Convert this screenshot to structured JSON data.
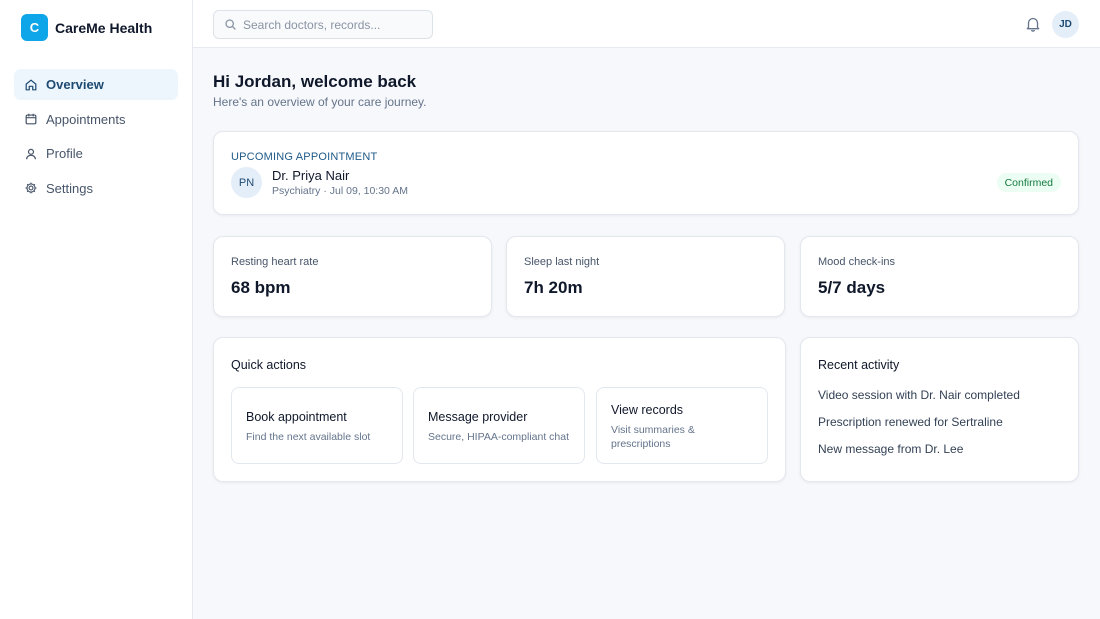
{
  "brand": {
    "logo_letter": "C",
    "name": "CareMe Health",
    "color": "#0ea5e9"
  },
  "nav": {
    "items": [
      {
        "label": "Overview",
        "icon": "home-icon",
        "active": true
      },
      {
        "label": "Appointments",
        "icon": "calendar-icon",
        "active": false
      },
      {
        "label": "Profile",
        "icon": "user-icon",
        "active": false
      },
      {
        "label": "Settings",
        "icon": "gear-icon",
        "active": false
      }
    ]
  },
  "topbar": {
    "search_placeholder": "Search doctors, records...",
    "notifications_icon": "bell-icon",
    "avatar_initials": "JD"
  },
  "main": {
    "greeting": "Hi Jordan, welcome back",
    "subtitle": "Here's an overview of your care journey."
  },
  "appointment": {
    "label": "UPCOMING APPOINTMENT",
    "doctor_initials": "PN",
    "doctor": "Dr. Priya Nair",
    "detail": "Psychiatry · Jul 09, 10:30 AM",
    "status": "Confirmed",
    "status_color": "#147a3f"
  },
  "stats": [
    {
      "label": "Resting heart rate",
      "value": "68 bpm"
    },
    {
      "label": "Sleep last night",
      "value": "7h 20m"
    },
    {
      "label": "Mood check-ins",
      "value": "5/7 days"
    }
  ],
  "quick_actions": {
    "title": "Quick actions",
    "items": [
      {
        "title": "Book appointment",
        "description": "Find the next available slot"
      },
      {
        "title": "Message provider",
        "description": "Secure, HIPAA-compliant chat"
      },
      {
        "title": "View records",
        "description": "Visit summaries & prescriptions"
      }
    ]
  },
  "recent_activity": {
    "title": "Recent activity",
    "items": [
      "Video session with Dr. Nair completed",
      "Prescription renewed for Sertraline",
      "New message from Dr. Lee"
    ]
  }
}
